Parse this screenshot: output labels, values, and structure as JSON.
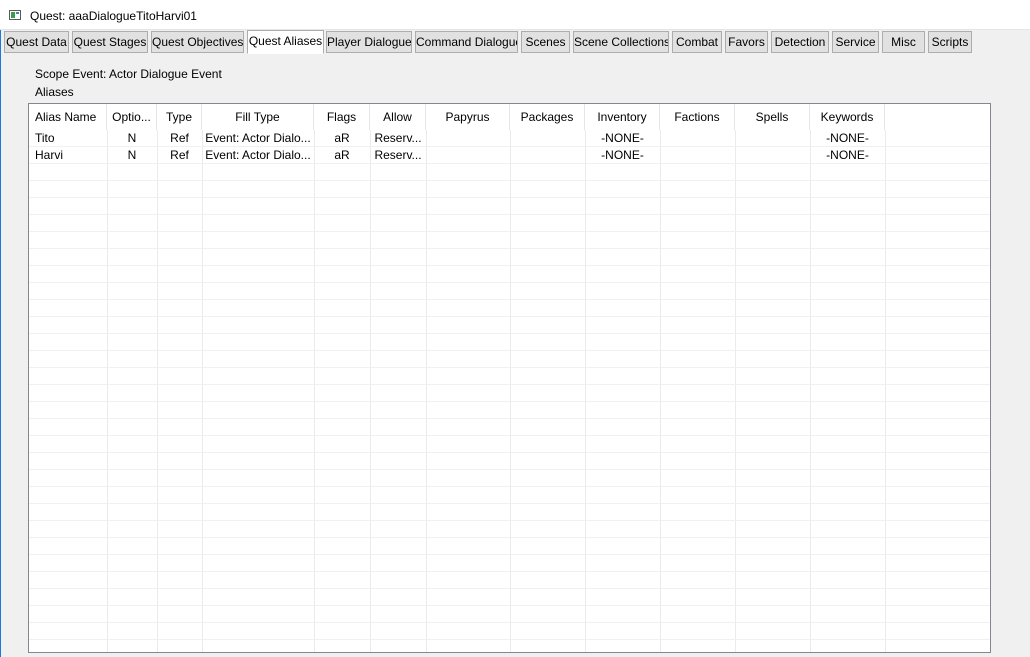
{
  "window": {
    "title": "Quest: aaaDialogueTitoHarvi01",
    "icon": "window-app-icon"
  },
  "tabs": [
    {
      "label": "Quest Data"
    },
    {
      "label": "Quest Stages"
    },
    {
      "label": "Quest Objectives"
    },
    {
      "label": "Quest Aliases",
      "active": true
    },
    {
      "label": "Player Dialogue"
    },
    {
      "label": "Command Dialogue"
    },
    {
      "label": "Scenes"
    },
    {
      "label": "Scene Collections"
    },
    {
      "label": "Combat"
    },
    {
      "label": "Favors"
    },
    {
      "label": "Detection"
    },
    {
      "label": "Service"
    },
    {
      "label": "Misc"
    },
    {
      "label": "Scripts"
    }
  ],
  "scope_event": "Scope Event: Actor Dialogue Event",
  "aliases_label": "Aliases",
  "table": {
    "columns": [
      "Alias Name",
      "Optio...",
      "Type",
      "Fill Type",
      "Flags",
      "Allow",
      "Papyrus",
      "Packages",
      "Inventory",
      "Factions",
      "Spells",
      "Keywords"
    ],
    "rows": [
      [
        "Tito",
        "N",
        "Ref",
        "Event: Actor Dialo...",
        "aR",
        "Reserv...",
        "",
        "",
        "-NONE-",
        "",
        "",
        "-NONE-"
      ],
      [
        "Harvi",
        "N",
        "Ref",
        "Event: Actor Dialo...",
        "aR",
        "Reserv...",
        "",
        "",
        "-NONE-",
        "",
        "",
        "-NONE-"
      ]
    ]
  }
}
